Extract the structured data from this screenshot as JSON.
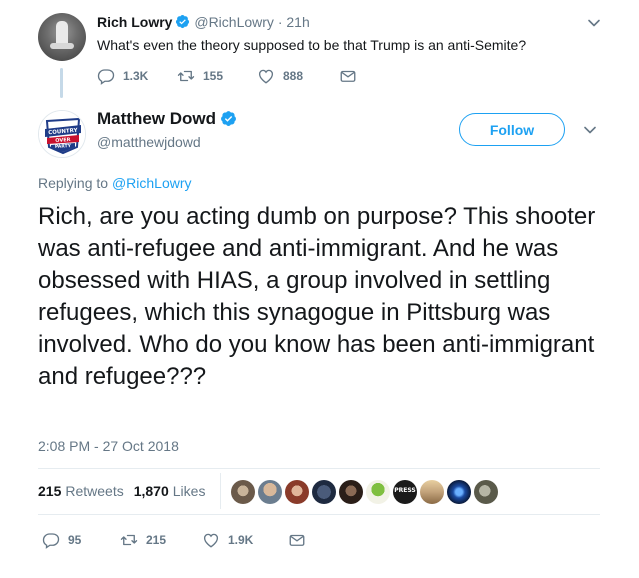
{
  "parent_tweet": {
    "name": "Rich Lowry",
    "handle": "@RichLowry",
    "separator": "·",
    "time": "21h",
    "text": "What's even the theory supposed to be that Trump is an anti-Semite?",
    "replies": "1.3K",
    "retweets": "155",
    "likes": "888"
  },
  "main_tweet": {
    "name": "Matthew Dowd",
    "handle": "@matthewjdowd",
    "follow_label": "Follow",
    "replying_prefix": "Replying to",
    "replying_to": "@RichLowry",
    "text": "Rich, are you acting dumb on purpose?  This shooter was anti-refugee and anti-immigrant. And he was obsessed with HIAS, a group involved in settling refugees, which this synagogue in Pittsburg was involved.  Who do you know has been anti-immigrant and refugee???",
    "timestamp": "2:08 PM - 27 Oct 2018",
    "retweet_count": "215",
    "retweet_label": "Retweets",
    "like_count": "1,870",
    "like_label": "Likes",
    "replies": "95",
    "retweets": "215",
    "likes": "1.9K"
  },
  "likers": [
    {
      "icon": "avatar-camera",
      "color": "#6b5a4a"
    },
    {
      "icon": "avatar-bald-man",
      "color": "#b08a6e"
    },
    {
      "icon": "avatar-red-hair",
      "color": "#8a3b2a"
    },
    {
      "icon": "avatar-group",
      "color": "#2b3a55"
    },
    {
      "icon": "avatar-dark",
      "color": "#3b2a22"
    },
    {
      "icon": "avatar-green-figure",
      "color": "#5a8a2a"
    },
    {
      "icon": "avatar-press",
      "color": "#1a1a1a",
      "text": "PRESS"
    },
    {
      "icon": "avatar-desert",
      "color": "#c2a27a"
    },
    {
      "icon": "avatar-earth",
      "color": "#0d2b5e"
    },
    {
      "icon": "avatar-sleeping",
      "color": "#7a7a6a"
    }
  ],
  "colors": {
    "link": "#1da1f2",
    "muted": "#657786",
    "text": "#14171a",
    "verified": "#1da1f2"
  }
}
